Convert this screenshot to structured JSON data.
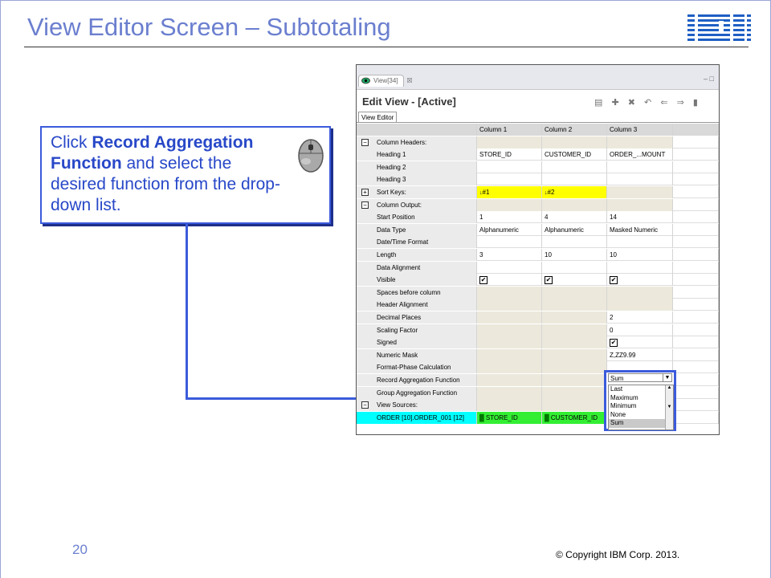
{
  "slide": {
    "title": "View Editor Screen – Subtotaling",
    "logo": "IBM",
    "page_number": "20",
    "copyright": "© Copyright  IBM Corp. 2013."
  },
  "callout": {
    "text_bold_1": "Record Aggregation Function",
    "text_pre": "Click ",
    "text_post": " and select the desired function from the drop-down list.",
    "icon": "mouse-icon"
  },
  "window": {
    "tab_label": "View[34]",
    "tab_close": "☒",
    "controls": "– □",
    "editor_title": "Edit View - [Active]",
    "inner_tab": "View Editor",
    "toolbar_icons": [
      "save-icon",
      "add-icon",
      "delete-icon",
      "undo-icon",
      "left-arrow-icon",
      "right-arrow-icon",
      "stop-icon"
    ],
    "columns": [
      "Column 1",
      "Column 2",
      "Column 3"
    ],
    "rows": [
      {
        "label": "Column Headers:",
        "section": true,
        "expander": "−",
        "values": [
          "",
          "",
          ""
        ]
      },
      {
        "label": "Heading 1",
        "values": [
          "STORE_ID",
          "CUSTOMER_ID",
          "ORDER_...MOUNT"
        ]
      },
      {
        "label": "Heading 2",
        "values": [
          "",
          "",
          ""
        ]
      },
      {
        "label": "Heading 3",
        "values": [
          "",
          "",
          ""
        ]
      },
      {
        "label": "Sort Keys:",
        "section": true,
        "expander": "+",
        "values": [
          "#1",
          "#2",
          ""
        ]
      },
      {
        "label": "Column Output:",
        "section": true,
        "expander": "−",
        "values": [
          "",
          "",
          ""
        ]
      },
      {
        "label": "Start Position",
        "values": [
          "1",
          "4",
          "14"
        ]
      },
      {
        "label": "Data Type",
        "values": [
          "Alphanumeric",
          "Alphanumeric",
          "Masked Numeric"
        ]
      },
      {
        "label": "Date/Time Format",
        "values": [
          "",
          "",
          ""
        ]
      },
      {
        "label": "Length",
        "values": [
          "3",
          "10",
          "10"
        ]
      },
      {
        "label": "Data Alignment",
        "values": [
          "",
          "",
          ""
        ]
      },
      {
        "label": "Visible",
        "values": [
          "✔",
          "✔",
          "✔"
        ]
      },
      {
        "label": "Spaces before column",
        "values": [
          "",
          "",
          ""
        ]
      },
      {
        "label": "Header Alignment",
        "values": [
          "",
          "",
          ""
        ]
      },
      {
        "label": "Decimal Places",
        "values": [
          "",
          "",
          "2"
        ]
      },
      {
        "label": "Scaling Factor",
        "values": [
          "",
          "",
          "0"
        ]
      },
      {
        "label": "Signed",
        "values": [
          "",
          "",
          "✔"
        ]
      },
      {
        "label": "Numeric Mask",
        "values": [
          "",
          "",
          "Z,ZZ9.99"
        ]
      },
      {
        "label": "Format-Phase Calculation",
        "values": [
          "",
          "",
          ""
        ]
      },
      {
        "label": "Record Aggregation Function",
        "values": [
          "",
          "",
          ""
        ]
      },
      {
        "label": "Group Aggregation Function",
        "values": [
          "",
          "",
          ""
        ]
      },
      {
        "label": "View Sources:",
        "section": true,
        "expander": "−",
        "values": [
          "",
          "",
          ""
        ]
      },
      {
        "label": "ORDER [10].ORDER_001 [12]",
        "values": [
          "STORE_ID",
          "CUSTOMER_ID",
          ""
        ]
      }
    ],
    "dropdown": {
      "selected": "Sum",
      "options": [
        "Last",
        "Maximum",
        "Minimum",
        "None",
        "Sum"
      ]
    }
  },
  "colors": {
    "title": "#6b7fcf",
    "callout_border": "#3b5bdb",
    "sort_key_highlight": "#ffff00",
    "source_label_highlight": "#00ffff",
    "source_field_highlight": "#33ee33"
  }
}
